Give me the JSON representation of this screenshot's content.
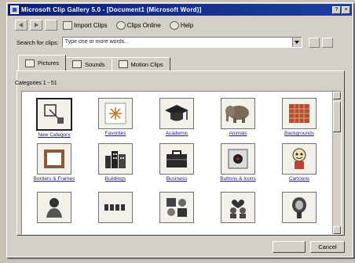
{
  "window": {
    "title": "Microsoft Clip Gallery 5.0 - [Document1 (Microsoft Word)]"
  },
  "titlebar_buttons": [
    "?",
    "×"
  ],
  "toolbar": {
    "import_label": "Import Clips",
    "online_label": "Clips Online",
    "help_label": "Help"
  },
  "search": {
    "label": "Search for clips:",
    "value": "Type one or more words..."
  },
  "tabs": [
    {
      "label": "Pictures"
    },
    {
      "label": "Sounds"
    },
    {
      "label": "Motion Clips"
    }
  ],
  "category_header": "Categories 1 - 51",
  "clips": [
    {
      "label": "New Category",
      "icon": "new-category-icon"
    },
    {
      "label": "Favorites",
      "icon": "favorites-icon"
    },
    {
      "label": "Academic",
      "icon": "academic-icon"
    },
    {
      "label": "Animals",
      "icon": "animals-icon"
    },
    {
      "label": "Backgrounds",
      "icon": "backgrounds-icon"
    },
    {
      "label": "Borders & Frames",
      "icon": "borders-frames-icon"
    },
    {
      "label": "Buildings",
      "icon": "buildings-icon"
    },
    {
      "label": "Business",
      "icon": "business-icon"
    },
    {
      "label": "Buttons & Icons",
      "icon": "buttons-icons-icon"
    },
    {
      "label": "Cartoons",
      "icon": "cartoons-icon"
    },
    {
      "label": "",
      "icon": "communication-icon"
    },
    {
      "label": "",
      "icon": "dividers-icon"
    },
    {
      "label": "",
      "icon": "entertainment-icon"
    },
    {
      "label": "",
      "icon": "family-icon"
    },
    {
      "label": "",
      "icon": "food-icon"
    }
  ],
  "bottom": {
    "cancel_label": "Cancel"
  }
}
